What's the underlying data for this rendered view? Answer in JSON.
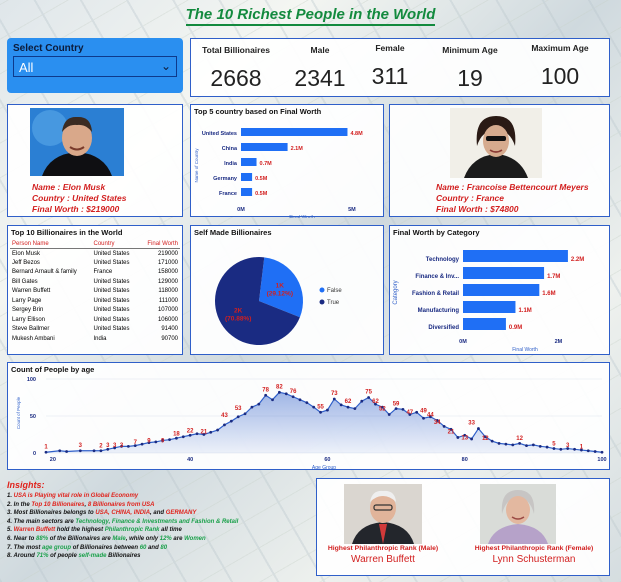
{
  "title": "The 10 Richest People in the World",
  "filter": {
    "label": "Select Country",
    "value": "All"
  },
  "kpis": [
    {
      "label": "Total Billionaires",
      "value": "2668"
    },
    {
      "label": "Male",
      "value": "2341"
    },
    {
      "label": "Female",
      "value": "311"
    },
    {
      "label": "Minimum Age",
      "value": "19"
    },
    {
      "label": "Maximum Age",
      "value": "100"
    }
  ],
  "richest_male": {
    "name": "Name : Elon Musk",
    "country": "Country : United States",
    "worth": "Final Worth : $219000"
  },
  "richest_female": {
    "name": "Name : Francoise Bettencourt Meyers",
    "country": "Country : France",
    "worth": "Final Worth : $74800"
  },
  "top_countries": {
    "title": "Top 5 country based on Final Worth",
    "ylabel": "Name of Country",
    "xlabel": "Final Worth",
    "ticks": [
      "0M",
      "5M"
    ]
  },
  "top_table": {
    "title": "Top 10 Billionaires in the World",
    "headers": [
      "Person Name",
      "Country",
      "Final Worth"
    ],
    "rows": [
      [
        "Elon Musk",
        "United States",
        "219000"
      ],
      [
        "Jeff Bezos",
        "United States",
        "171000"
      ],
      [
        "Bernard Arnault & family",
        "France",
        "158000"
      ],
      [
        "Bill Gates",
        "United States",
        "129000"
      ],
      [
        "Warren Buffett",
        "United States",
        "118000"
      ],
      [
        "Larry Page",
        "United States",
        "111000"
      ],
      [
        "Sergey Brin",
        "United States",
        "107000"
      ],
      [
        "Larry Ellison",
        "United States",
        "106000"
      ],
      [
        "Steve Ballmer",
        "United States",
        "91400"
      ],
      [
        "Mukesh Ambani",
        "India",
        "90700"
      ]
    ]
  },
  "self_made": {
    "title": "Self Made Billionaires",
    "legend": [
      "False",
      "True"
    ]
  },
  "category": {
    "title": "Final Worth by Category",
    "ylabel": "Category",
    "xlabel": "Final Worth",
    "ticks": [
      "0M",
      "2M"
    ]
  },
  "age": {
    "title": "Count of People by age",
    "ylabel": "Count of People",
    "xlabel": "Age Group",
    "yticks": [
      "100",
      "50",
      "0"
    ],
    "xticks": [
      "20",
      "40",
      "60",
      "80",
      "100"
    ]
  },
  "insights": {
    "heading": "Insights:",
    "lines": [
      [
        [
          "1. ",
          ""
        ],
        [
          "USA is Playing vital role in Global Economy",
          "rr"
        ]
      ],
      [
        [
          "2. In the ",
          ""
        ],
        [
          "Top 10 Billionaires",
          "rr"
        ],
        [
          ", ",
          ""
        ],
        [
          "8 Billionaires from USA",
          "rr"
        ]
      ],
      [
        [
          "3. Most Billionaires belongs to ",
          ""
        ],
        [
          "USA, CHINA, INDIA",
          "rr"
        ],
        [
          ", and ",
          ""
        ],
        [
          "GERMANY",
          "rr"
        ]
      ],
      [
        [
          "4. The main sectors are ",
          ""
        ],
        [
          "Technology, Finance & Investments and Fashion & Retail",
          "g"
        ]
      ],
      [
        [
          "5. ",
          ""
        ],
        [
          "Warren Buffett",
          "rr"
        ],
        [
          " hold the highest ",
          ""
        ],
        [
          "Philanthropic Rank",
          "g"
        ],
        [
          " all time",
          ""
        ]
      ],
      [
        [
          "6. Near to ",
          ""
        ],
        [
          "88%",
          "g"
        ],
        [
          " of the Billionaires are ",
          ""
        ],
        [
          "Male",
          "g"
        ],
        [
          ", while only ",
          ""
        ],
        [
          "12%",
          "g"
        ],
        [
          " are ",
          ""
        ],
        [
          "Women",
          "g"
        ]
      ],
      [
        [
          "7. The most ",
          ""
        ],
        [
          "age group",
          "g"
        ],
        [
          " of Billionaires between ",
          ""
        ],
        [
          "60",
          "g"
        ],
        [
          " and ",
          ""
        ],
        [
          "80",
          "g"
        ]
      ],
      [
        [
          "8. Around ",
          ""
        ],
        [
          "71%",
          "g"
        ],
        [
          " of people ",
          ""
        ],
        [
          "self-made",
          "g"
        ],
        [
          " Billionaires",
          ""
        ]
      ]
    ]
  },
  "philanthropy": {
    "male": {
      "caption": "Highest Philanthropic Rank (Male)",
      "name": "Warren Buffett"
    },
    "female": {
      "caption": "Highest Philanthropic Rank (Female)",
      "name": "Lynn Schusterman"
    }
  },
  "colors": {
    "bar": "#1f6ff5",
    "dark": "#1a2b82",
    "accent": "#d21f1f"
  },
  "chart_data": [
    {
      "type": "bar",
      "title": "Top 5 country based on Final Worth",
      "categories": [
        "United States",
        "China",
        "India",
        "Germany",
        "France"
      ],
      "values": [
        4.8,
        2.1,
        0.7,
        0.5,
        0.5
      ],
      "labels": [
        "4.8M",
        "2.1M",
        "0.7M",
        "0.5M",
        "0.5M"
      ],
      "xlabel": "Final Worth",
      "ylabel": "Name of Country",
      "xlim": [
        0,
        5.5
      ]
    },
    {
      "type": "pie",
      "title": "Self Made Billionaires",
      "categories": [
        "False",
        "True"
      ],
      "values": [
        29.12,
        70.88
      ],
      "labels": [
        "1K (29.12%)",
        "2K (70.88%)"
      ]
    },
    {
      "type": "bar",
      "title": "Final Worth by Category",
      "categories": [
        "Technology",
        "Finance & Inv...",
        "Fashion & Retail",
        "Manufacturing",
        "Diversified"
      ],
      "values": [
        2.2,
        1.7,
        1.6,
        1.1,
        0.9
      ],
      "labels": [
        "2.2M",
        "1.7M",
        "1.6M",
        "1.1M",
        "0.9M"
      ],
      "xlabel": "Final Worth",
      "ylabel": "Category",
      "xlim": [
        0,
        2.6
      ]
    },
    {
      "type": "area",
      "title": "Count of People by age",
      "xlabel": "Age Group",
      "ylabel": "Count of People",
      "ylim": [
        0,
        100
      ],
      "x": [
        19,
        21,
        22,
        24,
        26,
        27,
        28,
        29,
        30,
        31,
        32,
        33,
        34,
        35,
        36,
        37,
        38,
        39,
        40,
        41,
        42,
        43,
        44,
        45,
        46,
        47,
        48,
        49,
        50,
        51,
        52,
        53,
        54,
        55,
        56,
        57,
        58,
        59,
        60,
        61,
        62,
        63,
        64,
        65,
        66,
        67,
        68,
        69,
        70,
        71,
        72,
        73,
        74,
        75,
        76,
        77,
        78,
        79,
        80,
        81,
        82,
        83,
        84,
        85,
        86,
        87,
        88,
        89,
        90,
        91,
        92,
        93,
        94,
        95,
        96,
        97,
        98,
        99,
        100
      ],
      "y": [
        1,
        3,
        2,
        3,
        3,
        3,
        5,
        7,
        9,
        9,
        10,
        12,
        14,
        15,
        17,
        18,
        20,
        22,
        24,
        26,
        25,
        28,
        31,
        38,
        43,
        49,
        53,
        62,
        66,
        78,
        72,
        82,
        80,
        76,
        72,
        68,
        62,
        55,
        58,
        73,
        65,
        62,
        60,
        70,
        75,
        66,
        62,
        52,
        60,
        59,
        52,
        55,
        47,
        49,
        44,
        36,
        32,
        21,
        24,
        19,
        33,
        22,
        16,
        13,
        12,
        11,
        13,
        10,
        11,
        9,
        8,
        6,
        5,
        6,
        5,
        4,
        3,
        2,
        1
      ],
      "labels": [
        [
          "19",
          "1"
        ],
        [
          "24",
          "3"
        ],
        [
          "27",
          "2"
        ],
        [
          "28",
          "3"
        ],
        [
          "29",
          "3"
        ],
        [
          "30",
          "3"
        ],
        [
          "32",
          "7"
        ],
        [
          "34",
          "9"
        ],
        [
          "36",
          "9"
        ],
        [
          "38",
          "18"
        ],
        [
          "40",
          "22"
        ],
        [
          "42",
          "21"
        ],
        [
          "45",
          "43"
        ],
        [
          "47",
          "53"
        ],
        [
          "51",
          "78"
        ],
        [
          "53",
          "82"
        ],
        [
          "55",
          "76"
        ],
        [
          "59",
          "55"
        ],
        [
          "61",
          "73"
        ],
        [
          "63",
          "62"
        ],
        [
          "66",
          "75"
        ],
        [
          "67",
          "62"
        ],
        [
          "68",
          "52"
        ],
        [
          "70",
          "59"
        ],
        [
          "72",
          "47"
        ],
        [
          "74",
          "49"
        ],
        [
          "75",
          "44"
        ],
        [
          "76",
          "34"
        ],
        [
          "78",
          "21"
        ],
        [
          "80",
          "13"
        ],
        [
          "81",
          "33"
        ],
        [
          "83",
          "12"
        ],
        [
          "88",
          "12"
        ],
        [
          "93",
          "5"
        ],
        [
          "95",
          "3"
        ],
        [
          "97",
          "1"
        ]
      ]
    }
  ]
}
